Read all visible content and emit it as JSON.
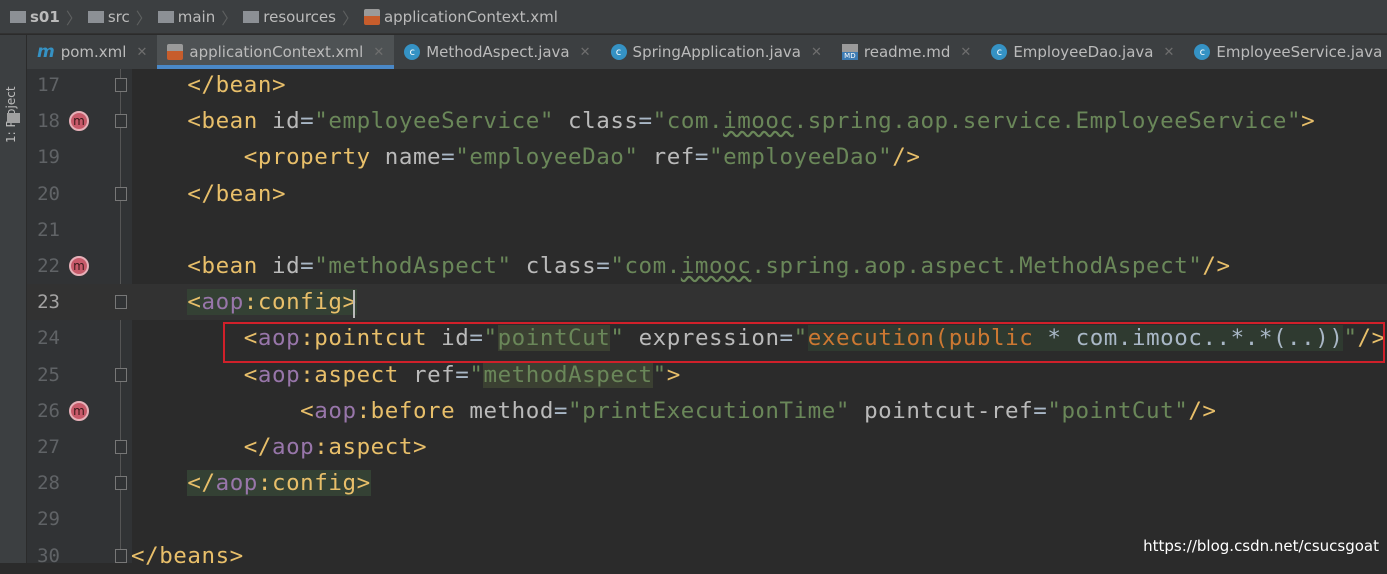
{
  "breadcrumb": [
    "s01",
    "src",
    "main",
    "resources",
    "applicationContext.xml"
  ],
  "side_panel": {
    "label": "1: Project"
  },
  "tabs": [
    {
      "label": "pom.xml",
      "icon": "maven-icon",
      "active": false
    },
    {
      "label": "applicationContext.xml",
      "icon": "spring-xml-icon",
      "active": true
    },
    {
      "label": "MethodAspect.java",
      "icon": "class-icon",
      "active": false
    },
    {
      "label": "SpringApplication.java",
      "icon": "class-icon",
      "active": false
    },
    {
      "label": "readme.md",
      "icon": "markdown-icon",
      "active": false
    },
    {
      "label": "EmployeeDao.java",
      "icon": "class-icon",
      "active": false
    },
    {
      "label": "EmployeeService.java",
      "icon": "class-icon",
      "active": false
    }
  ],
  "lines": [
    {
      "n": "17",
      "fold": true,
      "tokens": [
        [
          "    ",
          "p"
        ],
        [
          "</bean>",
          "t"
        ]
      ]
    },
    {
      "n": "18",
      "fold": true,
      "bean": true,
      "tokens": [
        [
          "    ",
          "p"
        ],
        [
          "<bean ",
          "t"
        ],
        [
          "id",
          "a"
        ],
        [
          "=",
          "p"
        ],
        [
          "\"employeeService\"",
          "v"
        ],
        [
          " ",
          "p"
        ],
        [
          "class",
          "a"
        ],
        [
          "=",
          "p"
        ],
        [
          "\"com.",
          "v"
        ],
        [
          "imooc",
          "v wavy"
        ],
        [
          ".spring.aop.service.EmployeeService\"",
          "v"
        ],
        [
          ">",
          "t"
        ]
      ]
    },
    {
      "n": "19",
      "tokens": [
        [
          "        ",
          "p"
        ],
        [
          "<property ",
          "t"
        ],
        [
          "name",
          "a"
        ],
        [
          "=",
          "p"
        ],
        [
          "\"employeeDao\"",
          "v"
        ],
        [
          " ",
          "p"
        ],
        [
          "ref",
          "a"
        ],
        [
          "=",
          "p"
        ],
        [
          "\"employeeDao\"",
          "v"
        ],
        [
          "/>",
          "t"
        ]
      ]
    },
    {
      "n": "20",
      "fold": true,
      "tokens": [
        [
          "    ",
          "p"
        ],
        [
          "</bean>",
          "t"
        ]
      ]
    },
    {
      "n": "21",
      "tokens": []
    },
    {
      "n": "22",
      "bean": true,
      "tokens": [
        [
          "    ",
          "p"
        ],
        [
          "<bean ",
          "t"
        ],
        [
          "id",
          "a"
        ],
        [
          "=",
          "p"
        ],
        [
          "\"methodAspect\"",
          "v"
        ],
        [
          " ",
          "p"
        ],
        [
          "class",
          "a"
        ],
        [
          "=",
          "p"
        ],
        [
          "\"com.",
          "v"
        ],
        [
          "imooc",
          "v wavy"
        ],
        [
          ".spring.aop.aspect.MethodAspect\"",
          "v"
        ],
        [
          "/>",
          "t"
        ]
      ]
    },
    {
      "n": "23",
      "fold": true,
      "cur": true,
      "tokens": [
        [
          "    ",
          "p"
        ],
        [
          "<",
          "t hl1"
        ],
        [
          "aop",
          "ns hl1"
        ],
        [
          ":config>",
          "t hl1"
        ]
      ]
    },
    {
      "n": "24",
      "tokens": [
        [
          "        ",
          "p"
        ],
        [
          "<",
          "t"
        ],
        [
          "aop",
          "ns"
        ],
        [
          ":pointcut ",
          "t"
        ],
        [
          "id",
          "a"
        ],
        [
          "=",
          "p"
        ],
        [
          "\"",
          "v"
        ],
        [
          "pointCut",
          "v hl2"
        ],
        [
          "\"",
          "v"
        ],
        [
          " ",
          "p"
        ],
        [
          "expression",
          "a"
        ],
        [
          "=",
          "p"
        ],
        [
          "\"",
          "v"
        ],
        [
          "execution(public",
          "k hl3"
        ],
        [
          " * com.imooc..*.*(..))",
          "p hl3"
        ],
        [
          "\"",
          "v"
        ],
        [
          "/>",
          "t"
        ]
      ]
    },
    {
      "n": "25",
      "fold": true,
      "tokens": [
        [
          "        ",
          "p"
        ],
        [
          "<",
          "t"
        ],
        [
          "aop",
          "ns"
        ],
        [
          ":aspect ",
          "t"
        ],
        [
          "ref",
          "a"
        ],
        [
          "=",
          "p"
        ],
        [
          "\"",
          "v"
        ],
        [
          "methodAspect",
          "v hl2"
        ],
        [
          "\"",
          "v"
        ],
        [
          ">",
          "t"
        ]
      ]
    },
    {
      "n": "26",
      "bean": true,
      "tokens": [
        [
          "            ",
          "p"
        ],
        [
          "<",
          "t"
        ],
        [
          "aop",
          "ns"
        ],
        [
          ":before ",
          "t"
        ],
        [
          "method",
          "a"
        ],
        [
          "=",
          "p"
        ],
        [
          "\"printExecutionTime\"",
          "v"
        ],
        [
          " ",
          "p"
        ],
        [
          "pointcut-ref",
          "a"
        ],
        [
          "=",
          "p"
        ],
        [
          "\"pointCut\"",
          "v"
        ],
        [
          "/>",
          "t"
        ]
      ]
    },
    {
      "n": "27",
      "fold": true,
      "tokens": [
        [
          "        ",
          "p"
        ],
        [
          "</",
          "t"
        ],
        [
          "aop",
          "ns"
        ],
        [
          ":aspect>",
          "t"
        ]
      ]
    },
    {
      "n": "28",
      "fold": true,
      "tokens": [
        [
          "    ",
          "p"
        ],
        [
          "</",
          "t hl1"
        ],
        [
          "aop",
          "ns hl1"
        ],
        [
          ":config>",
          "t hl1"
        ]
      ]
    },
    {
      "n": "29",
      "tokens": []
    },
    {
      "n": "30",
      "fold": true,
      "tokens": [
        [
          "</beans>",
          "t"
        ]
      ]
    }
  ],
  "watermark": "https://blog.csdn.net/csucsgoat"
}
